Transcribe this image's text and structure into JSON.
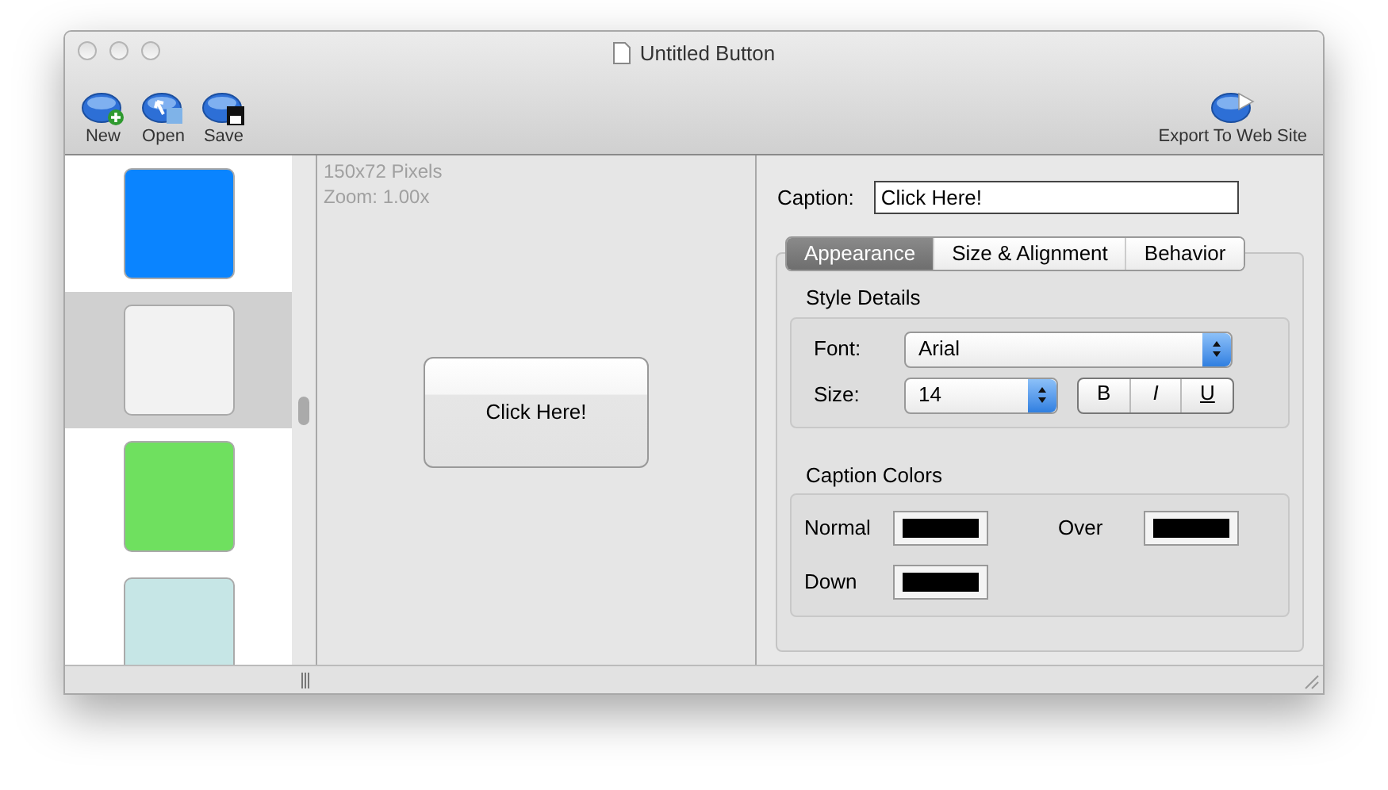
{
  "window": {
    "title": "Untitled Button"
  },
  "toolbar": {
    "left": [
      {
        "label": "New",
        "kind": "new"
      },
      {
        "label": "Open",
        "kind": "open"
      },
      {
        "label": "Save",
        "kind": "save"
      }
    ],
    "right": [
      {
        "label": "Export To Web Site",
        "kind": "export"
      }
    ]
  },
  "styles": [
    {
      "color": "#0a84ff",
      "selected": false
    },
    {
      "color": "#f2f2f2",
      "selected": true
    },
    {
      "color": "#6fe05f",
      "selected": false
    },
    {
      "color": "#c6e6e6",
      "selected": false
    }
  ],
  "canvas": {
    "size": "150x72 Pixels",
    "zoom": "Zoom: 1.00x",
    "preview_caption": "Click Here!"
  },
  "caption": {
    "label": "Caption:",
    "value": "Click Here!"
  },
  "tabs": [
    {
      "label": "Appearance",
      "selected": true
    },
    {
      "label": "Size & Alignment",
      "selected": false
    },
    {
      "label": "Behavior",
      "selected": false
    }
  ],
  "style_details": {
    "title": "Style Details",
    "font_label": "Font:",
    "font": "Arial",
    "size_label": "Size:",
    "size": "14",
    "format_buttons": [
      "B",
      "I",
      "U"
    ]
  },
  "caption_colors": {
    "title": "Caption Colors",
    "wells": [
      {
        "label": "Normal",
        "color": "#000000"
      },
      {
        "label": "Over",
        "color": "#000000"
      },
      {
        "label": "Down",
        "color": "#000000"
      }
    ]
  }
}
